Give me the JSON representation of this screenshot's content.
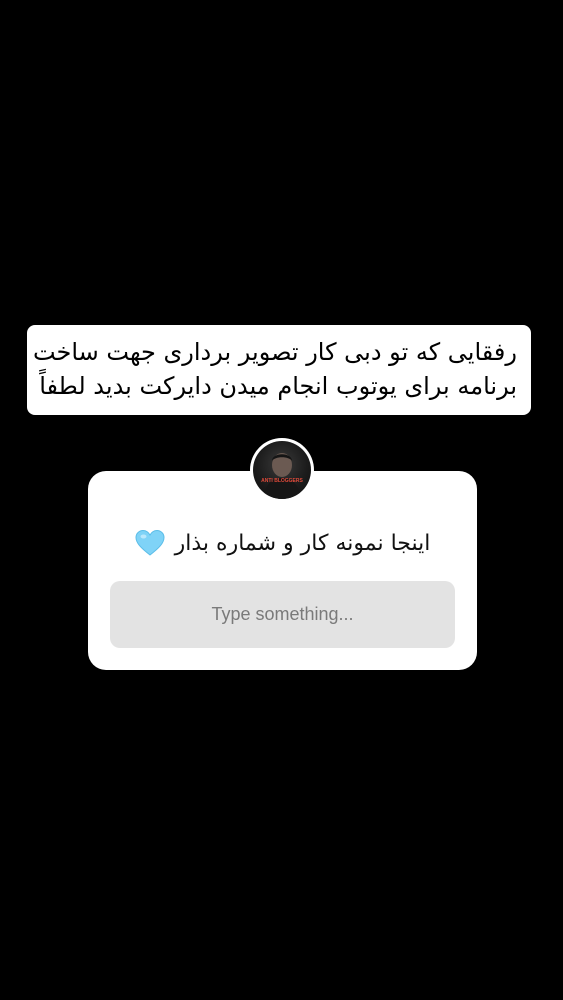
{
  "caption": {
    "line1": "رفقایی که تو دبی کار تصویر برداری جهت ساخت",
    "line2": "برنامه برای یوتوب انجام میدن دایرکت بدید لطفاً"
  },
  "question_sticker": {
    "avatar_text": "ANTI BLOGGERS",
    "question": "اینجا نمونه کار و شماره بذار",
    "emoji_icon": "light-blue-heart-icon",
    "emoji_color": "#7fd3f7",
    "placeholder": "Type something..."
  },
  "colors": {
    "background": "#000000",
    "card": "#ffffff",
    "field": "#e3e3e3",
    "placeholder_text": "#7a7a7a"
  }
}
